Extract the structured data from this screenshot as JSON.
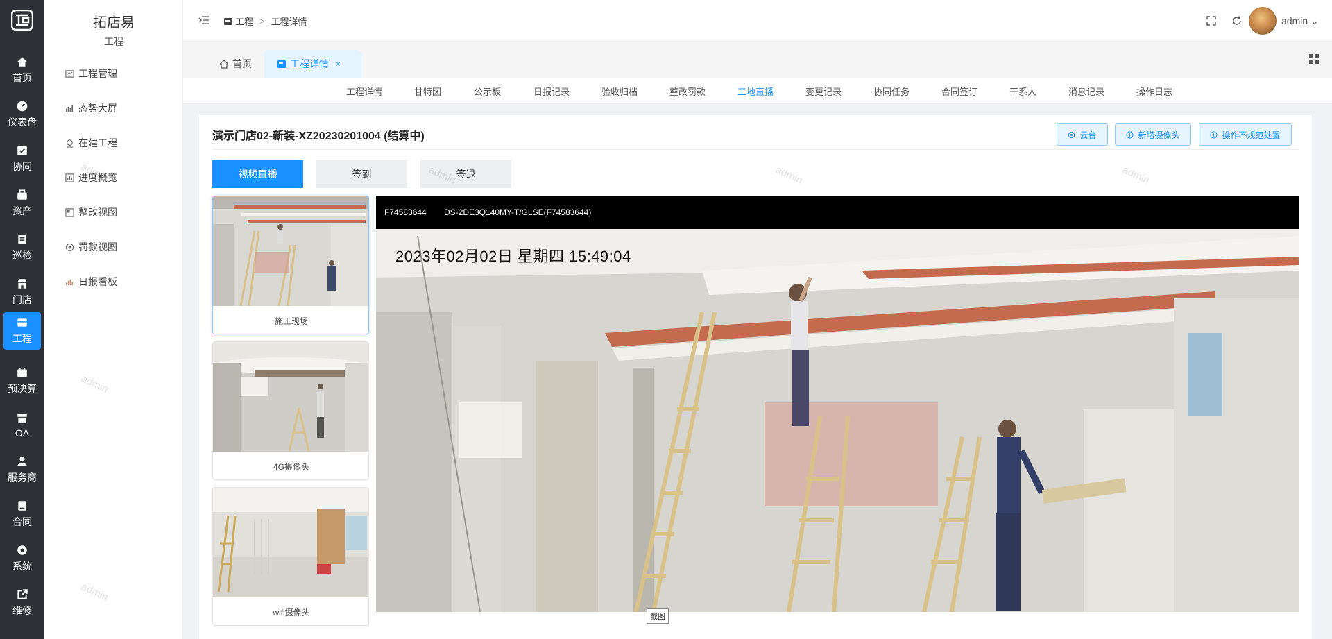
{
  "rail": {
    "items": [
      {
        "label": "首页",
        "icon": "home-icon"
      },
      {
        "label": "仪表盘",
        "icon": "dashboard-icon"
      },
      {
        "label": "协同",
        "icon": "collab-icon"
      },
      {
        "label": "资产",
        "icon": "asset-icon"
      },
      {
        "label": "巡检",
        "icon": "inspect-icon"
      },
      {
        "label": "门店",
        "icon": "store-icon"
      },
      {
        "label": "工程",
        "icon": "project-icon"
      },
      {
        "label": "预决算",
        "icon": "budget-icon"
      },
      {
        "label": "OA",
        "icon": "oa-icon"
      },
      {
        "label": "服务商",
        "icon": "provider-icon"
      },
      {
        "label": "合同",
        "icon": "contract-icon"
      },
      {
        "label": "系统",
        "icon": "system-icon"
      },
      {
        "label": "维修",
        "icon": "repair-icon"
      }
    ],
    "active": "工程"
  },
  "sidebar": {
    "brand": "拓店易",
    "section": "工程",
    "items": [
      {
        "label": "工程管理"
      },
      {
        "label": "态势大屏"
      },
      {
        "label": "在建工程"
      },
      {
        "label": "进度概览"
      },
      {
        "label": "整改视图"
      },
      {
        "label": "罚款视图"
      },
      {
        "label": "日报看板"
      }
    ]
  },
  "header": {
    "breadcrumb": [
      "工程",
      "工程详情"
    ],
    "separator": ">",
    "user": "admin ⌄"
  },
  "tabs": [
    {
      "label": "首页"
    },
    {
      "label": "工程详情",
      "close": "×"
    }
  ],
  "subnav": {
    "items": [
      "工程详情",
      "甘特图",
      "公示板",
      "日报记录",
      "验收归档",
      "整改罚款",
      "工地直播",
      "变更记录",
      "协同任务",
      "合同签订",
      "干系人",
      "消息记录",
      "操作日志"
    ],
    "active": "工地直播"
  },
  "card": {
    "title": "演示门店02-新装-XZ20230201004 (结算中)",
    "tools": [
      "云台",
      "新增摄像头",
      "操作不规范处置"
    ],
    "modes": [
      "视频直播",
      "签到",
      "签退"
    ],
    "cameras": [
      {
        "label": "施工现场"
      },
      {
        "label": "4G摄像头"
      },
      {
        "label": "wifi摄像头"
      }
    ]
  },
  "video": {
    "device_id": "F74583644",
    "model": "DS-2DE3Q140MY-T/GLSE(F74583644)",
    "timestamp": "2023年02月02日  星期四   15:49:04",
    "snapshot_label": "截图"
  },
  "watermark": "admin",
  "colors": {
    "primary": "#1890ff",
    "rail": "#2f3136"
  }
}
